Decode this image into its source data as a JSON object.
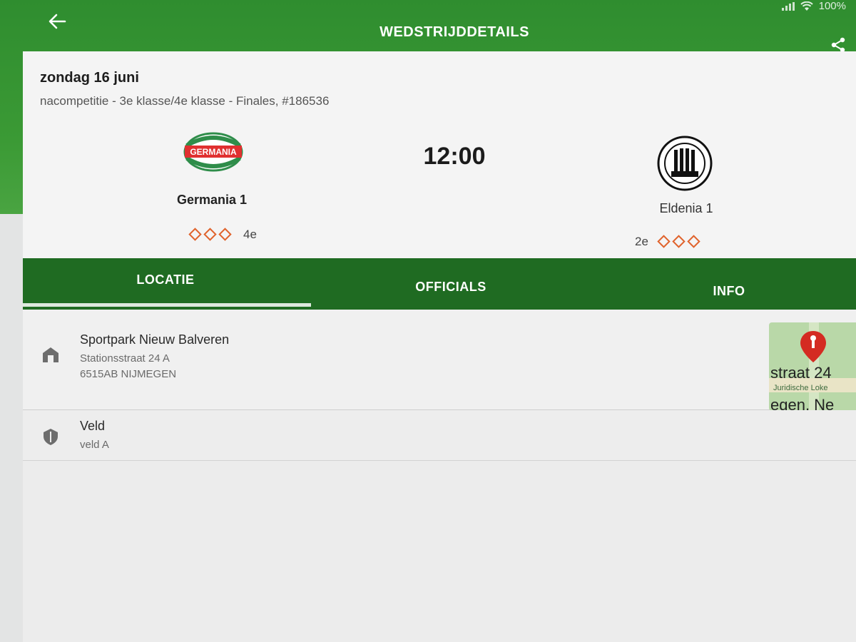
{
  "status": {
    "battery": "100%"
  },
  "header": {
    "title": "WEDSTRIJDDETAILS"
  },
  "match": {
    "date": "zondag 16 juni",
    "competition": "nacompetitie - 3e klasse/4e klasse - Finales, #186536",
    "time": "12:00",
    "home": {
      "name": "Germania 1",
      "rank": "4e",
      "logo_text": "GERMANIA"
    },
    "away": {
      "name": "Eldenia 1",
      "rank": "2e"
    }
  },
  "tabs": [
    {
      "label": "LOCATIE",
      "active": true
    },
    {
      "label": "OFFICIALS",
      "active": false
    },
    {
      "label": "INFO",
      "active": false
    }
  ],
  "location": {
    "venue": "Sportpark Nieuw Balveren",
    "street": "Stationsstraat 24 A",
    "city": "6515AB NIJMEGEN",
    "map": {
      "line1": "straat 24",
      "line2": "Juridische Loke",
      "line3": "egen, Ne"
    }
  },
  "field": {
    "label": "Veld",
    "value": "veld A"
  },
  "colors": {
    "primary": "#2f8d2f",
    "tab_bar": "#1f6b22",
    "rank_diamond": "#e0632c",
    "map_pin": "#d42b22"
  },
  "icons": [
    "back-arrow-icon",
    "share-icon",
    "building-icon",
    "field-pin-icon",
    "map-pin-icon",
    "wifi-icon",
    "signal-icon"
  ]
}
